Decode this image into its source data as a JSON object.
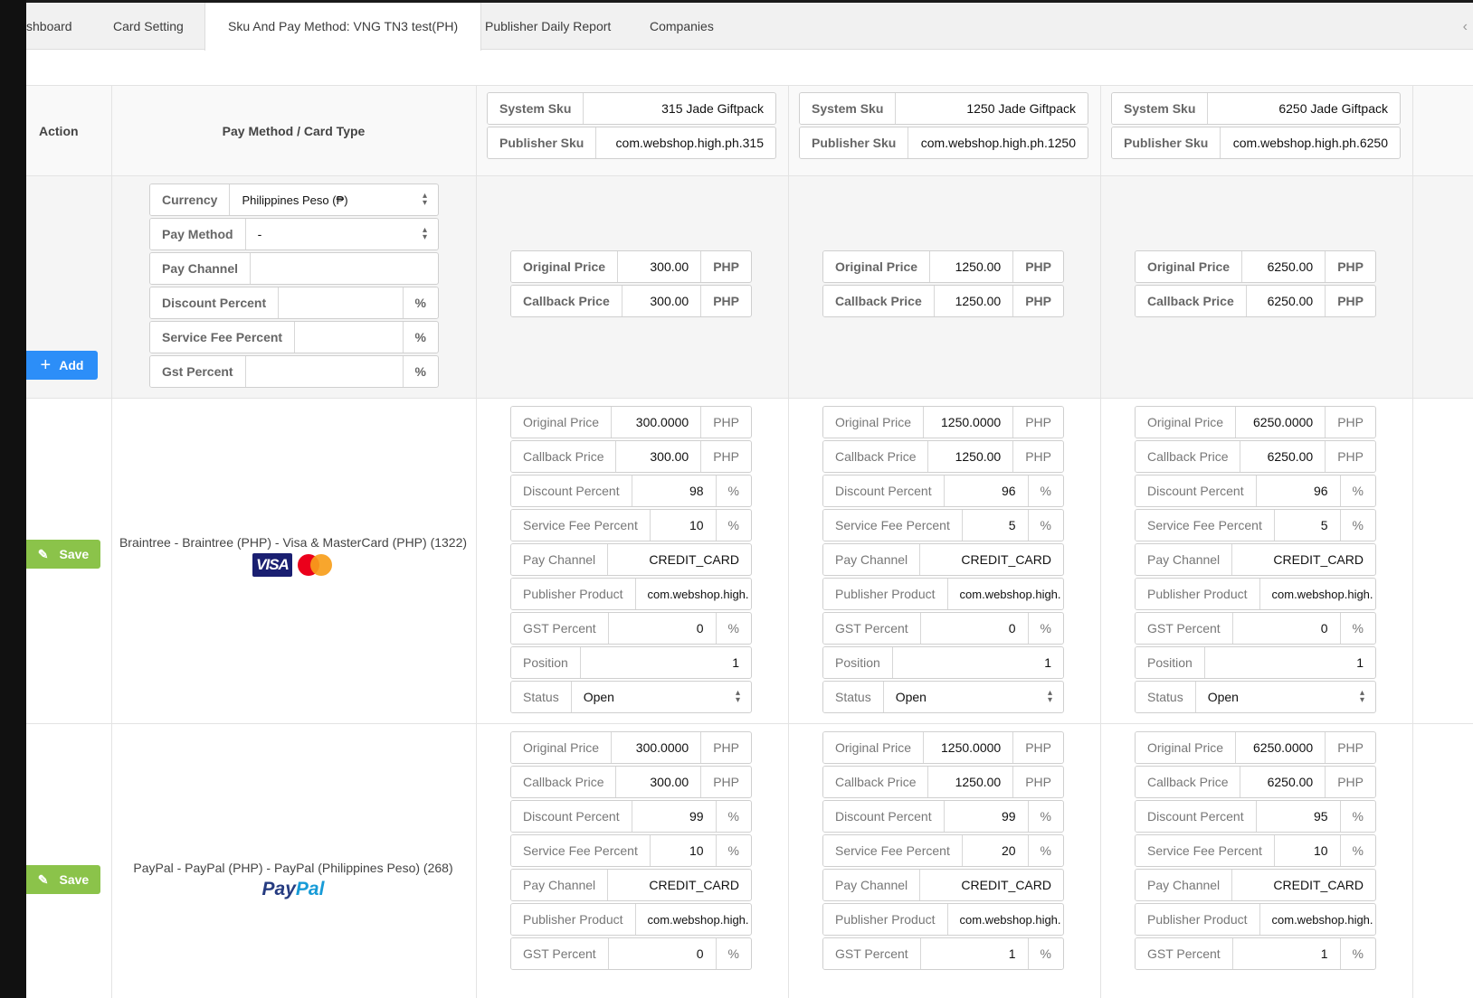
{
  "tabs": [
    {
      "label": "shboard"
    },
    {
      "label": "Card Setting"
    },
    {
      "label": "Sku And Pay Method: VNG TN3 test(PH)"
    },
    {
      "label": "Publisher Daily Report"
    },
    {
      "label": "Companies"
    }
  ],
  "header": {
    "action": "Action",
    "pay_method": "Pay Method / Card Type"
  },
  "sku_labels": {
    "system": "System Sku",
    "publisher": "Publisher Sku"
  },
  "skus": [
    {
      "system": "315 Jade Giftpack",
      "publisher": "com.webshop.high.ph.315"
    },
    {
      "system": "1250 Jade Giftpack",
      "publisher": "com.webshop.high.ph.1250"
    },
    {
      "system": "6250 Jade Giftpack",
      "publisher": "com.webshop.high.ph.6250"
    }
  ],
  "add_row": {
    "button": "Add",
    "labels": {
      "currency": "Currency",
      "pay_method": "Pay Method",
      "pay_channel": "Pay Channel",
      "discount": "Discount Percent",
      "service_fee": "Service Fee Percent",
      "gst": "Gst Percent"
    },
    "currency_value": "Philippines Peso (₱)",
    "pay_method_value": "-",
    "pay_channel_value": "",
    "pct": "%",
    "price_labels": {
      "original": "Original Price",
      "callback": "Callback Price"
    },
    "unit": "PHP",
    "prices": [
      {
        "original": "300.00",
        "callback": "300.00"
      },
      {
        "original": "1250.00",
        "callback": "1250.00"
      },
      {
        "original": "6250.00",
        "callback": "6250.00"
      }
    ]
  },
  "field_labels": {
    "original": "Original Price",
    "callback": "Callback Price",
    "discount": "Discount Percent",
    "service_fee": "Service Fee Percent",
    "pay_channel": "Pay Channel",
    "publisher_product": "Publisher Product",
    "gst": "GST Percent",
    "position": "Position",
    "status": "Status"
  },
  "unit": "PHP",
  "pct": "%",
  "methods": [
    {
      "save": "Save",
      "name": "Braintree - Braintree (PHP) - Visa & MasterCard (PHP) (1322)",
      "logo_text": "VISA",
      "cells": [
        {
          "original": "300.0000",
          "callback": "300.00",
          "discount": "98",
          "service_fee": "10",
          "pay_channel": "CREDIT_CARD",
          "publisher_product": "com.webshop.high.",
          "gst": "0",
          "position": "1",
          "status": "Open"
        },
        {
          "original": "1250.0000",
          "callback": "1250.00",
          "discount": "96",
          "service_fee": "5",
          "pay_channel": "CREDIT_CARD",
          "publisher_product": "com.webshop.high.",
          "gst": "0",
          "position": "1",
          "status": "Open"
        },
        {
          "original": "6250.0000",
          "callback": "6250.00",
          "discount": "96",
          "service_fee": "5",
          "pay_channel": "CREDIT_CARD",
          "publisher_product": "com.webshop.high.",
          "gst": "0",
          "position": "1",
          "status": "Open"
        }
      ]
    },
    {
      "save": "Save",
      "name": "PayPal - PayPal (PHP) - PayPal (Philippines Peso) (268)",
      "logo_text": "PayPal",
      "cells": [
        {
          "original": "300.0000",
          "callback": "300.00",
          "discount": "99",
          "service_fee": "10",
          "pay_channel": "CREDIT_CARD",
          "publisher_product": "com.webshop.high.",
          "gst": "0"
        },
        {
          "original": "1250.0000",
          "callback": "1250.00",
          "discount": "99",
          "service_fee": "20",
          "pay_channel": "CREDIT_CARD",
          "publisher_product": "com.webshop.high.",
          "gst": "1"
        },
        {
          "original": "6250.0000",
          "callback": "6250.00",
          "discount": "95",
          "service_fee": "10",
          "pay_channel": "CREDIT_CARD",
          "publisher_product": "com.webshop.high.",
          "gst": "1"
        }
      ]
    }
  ],
  "colors": {
    "add_button": "#2c8ef8",
    "save_button": "#8bc34a",
    "visa": "#1a1f71",
    "mc_red": "#eb001b",
    "mc_orange": "#f79e1b",
    "paypal_dark": "#253b80",
    "paypal_light": "#179bd7"
  }
}
